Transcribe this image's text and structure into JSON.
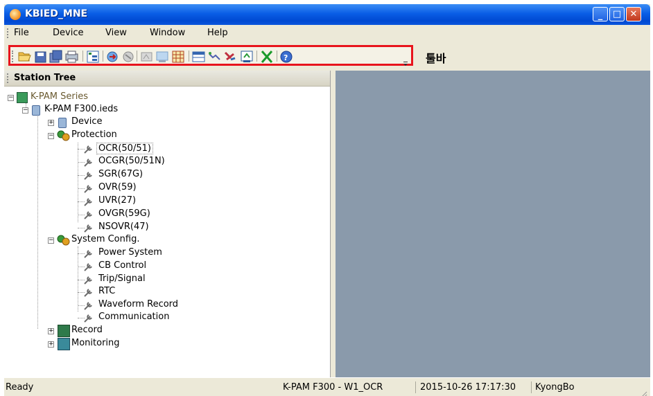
{
  "window": {
    "title": "KBIED_MNE"
  },
  "menu": [
    "File",
    "Device",
    "View",
    "Window",
    "Help"
  ],
  "toolbar": {
    "caption": "툴바",
    "buttons": [
      "open-icon",
      "save-icon",
      "save-all-icon",
      "print-icon",
      "tree-view-icon",
      "connect-icon",
      "disconnect-icon",
      "upload-icon",
      "download-icon",
      "grid-icon",
      "table-icon",
      "chart-icon",
      "compare-icon",
      "export-icon",
      "delete-icon",
      "help-icon"
    ]
  },
  "tree": {
    "header": "Station Tree",
    "root": "K-PAM Series",
    "ied": "K-PAM F300.ieds",
    "device": "Device",
    "protection": "Protection",
    "protection_items": [
      "OCR(50/51)",
      "OCGR(50/51N)",
      "SGR(67G)",
      "OVR(59)",
      "UVR(27)",
      "OVGR(59G)",
      "NSOVR(47)"
    ],
    "system_config": "System Config.",
    "system_items": [
      "Power System",
      "CB Control",
      "Trip/Signal",
      "RTC",
      "Waveform Record",
      "Communication"
    ],
    "record": "Record",
    "monitoring": "Monitoring"
  },
  "status": {
    "ready": "Ready",
    "context": "K-PAM F300 - W1_OCR",
    "datetime": "2015-10-26 17:17:30",
    "user": "KyongBo"
  },
  "colors": {
    "toolbar_highlight": "#e8141c",
    "workspace": "#8a9aab",
    "titlebar": "#0a5ee6"
  }
}
